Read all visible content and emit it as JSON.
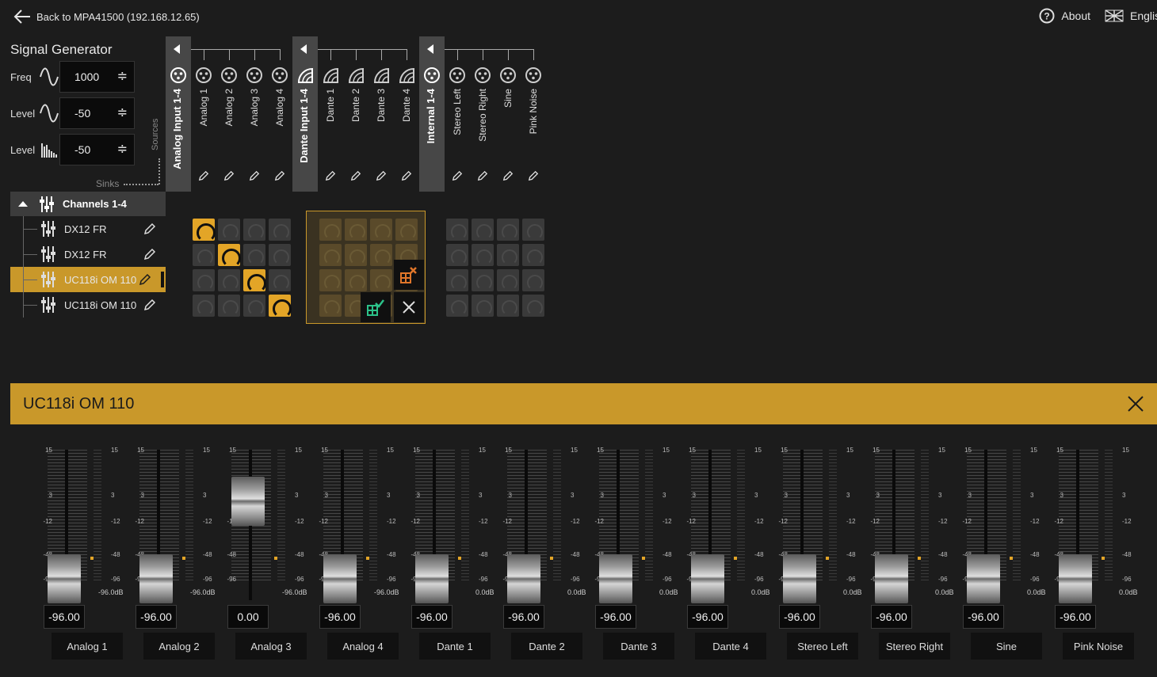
{
  "header": {
    "back_label": "Back to MPA41500 (192.168.12.65)",
    "about_label": "About",
    "language_label": "English"
  },
  "signal_generator": {
    "title": "Signal Generator",
    "freq_label": "Freq",
    "freq_value": "1000",
    "level1_label": "Level",
    "level1_value": "-50",
    "level2_label": "Level",
    "level2_value": "-50"
  },
  "axis": {
    "sources": "Sources",
    "sinks": "Sinks"
  },
  "sources": {
    "analog": {
      "group": "Analog Input 1-4",
      "items": [
        "Analog 1",
        "Analog 2",
        "Analog 3",
        "Analog 4"
      ]
    },
    "dante": {
      "group": "Dante Input 1-4",
      "items": [
        "Dante 1",
        "Dante 2",
        "Dante 3",
        "Dante 4"
      ]
    },
    "internal": {
      "group": "Internal 1-4",
      "items": [
        "Stereo Left",
        "Stereo Right",
        "Sine",
        "Pink Noise"
      ]
    }
  },
  "sinks": {
    "group": "Channels 1-4",
    "items": [
      "DX12 FR",
      "DX12 FR",
      "UC118i OM 110",
      "UC118i OM 110"
    ],
    "selected_index": 2
  },
  "matrix": {
    "analog_active_diagonal": [
      0,
      1,
      2,
      3
    ]
  },
  "panel": {
    "title": "UC118i OM 110",
    "scale": [
      "15",
      "3",
      "-12",
      "-48",
      "-96"
    ],
    "faders": [
      {
        "name": "Analog 1",
        "value": "-96.00",
        "db": "-96.0dB",
        "level": 0
      },
      {
        "name": "Analog 2",
        "value": "-96.00",
        "db": "-96.0dB",
        "level": 0
      },
      {
        "name": "Analog 3",
        "value": "0.00",
        "db": "-96.0dB",
        "level": 1
      },
      {
        "name": "Analog 4",
        "value": "-96.00",
        "db": "-96.0dB",
        "level": 0
      },
      {
        "name": "Dante 1",
        "value": "-96.00",
        "db": "0.0dB",
        "level": 0
      },
      {
        "name": "Dante 2",
        "value": "-96.00",
        "db": "0.0dB",
        "level": 0
      },
      {
        "name": "Dante 3",
        "value": "-96.00",
        "db": "0.0dB",
        "level": 0
      },
      {
        "name": "Dante 4",
        "value": "-96.00",
        "db": "0.0dB",
        "level": 0
      },
      {
        "name": "Stereo Left",
        "value": "-96.00",
        "db": "0.0dB",
        "level": 0
      },
      {
        "name": "Stereo Right",
        "value": "-96.00",
        "db": "0.0dB",
        "level": 0
      },
      {
        "name": "Sine",
        "value": "-96.00",
        "db": "0.0dB",
        "level": 0
      },
      {
        "name": "Pink Noise",
        "value": "-96.00",
        "db": "0.0dB",
        "level": 0
      }
    ]
  },
  "colors": {
    "accent": "#c9982a",
    "active_cell": "#e3a527",
    "background": "#1c1c1c"
  }
}
